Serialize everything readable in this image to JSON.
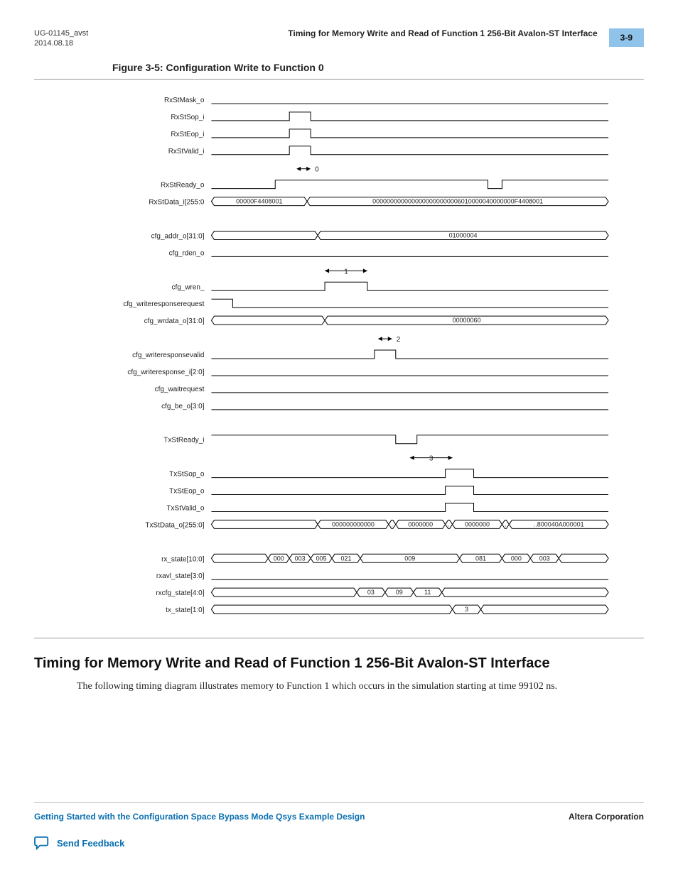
{
  "header": {
    "doc_id": "UG-01145_avst",
    "date": "2014.08.18",
    "running_title": "Timing for Memory Write and Read of Function 1 256-Bit Avalon-ST Interface",
    "page_number": "3-9"
  },
  "figure": {
    "caption": "Figure 3-5: Configuration Write to Function 0",
    "signals": [
      "RxStMask_o",
      "RxStSop_i",
      "RxStEop_i",
      "RxStValid_i",
      "",
      "RxStReady_o",
      "RxStData_i[255:0",
      "",
      "cfg_addr_o[31:0]",
      "cfg_rden_o",
      "",
      "cfg_wren_",
      "cfg_writeresponserequest",
      "cfg_wrdata_o[31:0]",
      "",
      "cfg_writeresponsevalid",
      "cfg_writeresponse_i[2:0]",
      "cfg_waitrequest",
      "cfg_be_o[3:0]",
      "",
      "TxStReady_i",
      "",
      "TxStSop_o",
      "TxStEop_o",
      "TxStValid_o",
      "TxStData_o[255:0]",
      "",
      "rx_state[10:0]",
      "rxavl_state[3:0]",
      "rxcfg_state[4:0]",
      "tx_state[1:0]"
    ],
    "bus_values": {
      "rxstdata_a": "00000F4408001",
      "rxstdata_b": "0000000000000000000000006010000040000000F4408001",
      "cfg_addr": "01000004",
      "cfg_wrdata": "00000060",
      "txstdata_a": "000000000000",
      "txstdata_b": "0000000",
      "txstdata_c": "0000000",
      "txstdata_d": "..800040A000001",
      "rx_state": [
        "000",
        "003",
        "005",
        "021",
        "009",
        "081",
        "000",
        "003"
      ],
      "rxcfg_state": [
        "03",
        "09",
        "11"
      ],
      "tx_state": "3"
    },
    "markers": [
      "0",
      "1",
      "2",
      "3"
    ]
  },
  "section": {
    "heading": "Timing for Memory Write and Read of Function 1 256-Bit Avalon-ST Interface",
    "body": "The following timing diagram illustrates memory to Function 1 which occurs in the simulation starting at time 99102 ns."
  },
  "footer": {
    "link_text": "Getting Started with the Configuration Space Bypass Mode Qsys Example Design",
    "corp": "Altera Corporation",
    "feedback": "Send Feedback"
  }
}
